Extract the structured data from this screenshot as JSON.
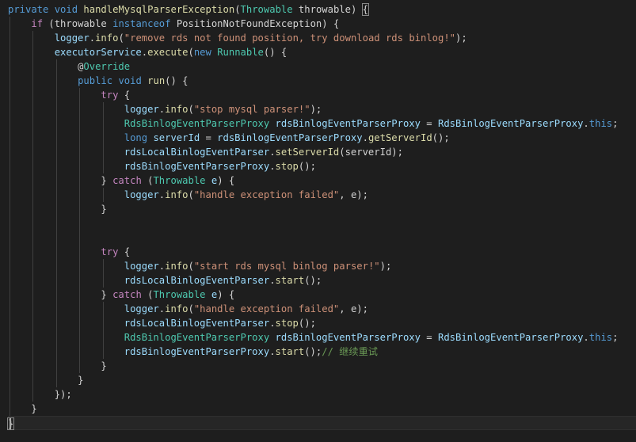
{
  "editor": {
    "lines": [
      {
        "tokens": [
          {
            "t": "private",
            "c": "kw"
          },
          {
            "t": " ",
            "c": "pn"
          },
          {
            "t": "void",
            "c": "kw"
          },
          {
            "t": " ",
            "c": "pn"
          },
          {
            "t": "handleMysqlParserException",
            "c": "fn"
          },
          {
            "t": "(",
            "c": "pn"
          },
          {
            "t": "Throwable",
            "c": "ty"
          },
          {
            "t": " throwable) ",
            "c": "pn"
          },
          {
            "t": "{",
            "c": "pn brk"
          }
        ]
      },
      {
        "tokens": [
          {
            "t": "    ",
            "c": "pn"
          },
          {
            "t": "if",
            "c": "ctl"
          },
          {
            "t": " (throwable ",
            "c": "pn"
          },
          {
            "t": "instanceof",
            "c": "kw"
          },
          {
            "t": " PositionNotFoundException) {",
            "c": "pn"
          }
        ]
      },
      {
        "tokens": [
          {
            "t": "        ",
            "c": "pn"
          },
          {
            "t": "logger",
            "c": "var"
          },
          {
            "t": ".",
            "c": "pn"
          },
          {
            "t": "info",
            "c": "fn"
          },
          {
            "t": "(",
            "c": "pn"
          },
          {
            "t": "\"remove rds not found position, try download rds binlog!\"",
            "c": "str"
          },
          {
            "t": ");",
            "c": "pn"
          }
        ]
      },
      {
        "tokens": [
          {
            "t": "        ",
            "c": "pn"
          },
          {
            "t": "executorService",
            "c": "var"
          },
          {
            "t": ".",
            "c": "pn"
          },
          {
            "t": "execute",
            "c": "fn"
          },
          {
            "t": "(",
            "c": "pn"
          },
          {
            "t": "new",
            "c": "kw"
          },
          {
            "t": " ",
            "c": "pn"
          },
          {
            "t": "Runnable",
            "c": "ty"
          },
          {
            "t": "() {",
            "c": "pn"
          }
        ]
      },
      {
        "tokens": [
          {
            "t": "            ",
            "c": "pn"
          },
          {
            "t": "@",
            "c": "pn"
          },
          {
            "t": "Override",
            "c": "ty"
          }
        ]
      },
      {
        "tokens": [
          {
            "t": "            ",
            "c": "pn"
          },
          {
            "t": "public",
            "c": "kw"
          },
          {
            "t": " ",
            "c": "pn"
          },
          {
            "t": "void",
            "c": "kw"
          },
          {
            "t": " ",
            "c": "pn"
          },
          {
            "t": "run",
            "c": "fn"
          },
          {
            "t": "() {",
            "c": "pn"
          }
        ]
      },
      {
        "tokens": [
          {
            "t": "                ",
            "c": "pn"
          },
          {
            "t": "try",
            "c": "ctl"
          },
          {
            "t": " {",
            "c": "pn"
          }
        ]
      },
      {
        "tokens": [
          {
            "t": "                    ",
            "c": "pn"
          },
          {
            "t": "logger",
            "c": "var"
          },
          {
            "t": ".",
            "c": "pn"
          },
          {
            "t": "info",
            "c": "fn"
          },
          {
            "t": "(",
            "c": "pn"
          },
          {
            "t": "\"stop mysql parser!\"",
            "c": "str"
          },
          {
            "t": ");",
            "c": "pn"
          }
        ]
      },
      {
        "tokens": [
          {
            "t": "                    ",
            "c": "pn"
          },
          {
            "t": "RdsBinlogEventParserProxy",
            "c": "ty"
          },
          {
            "t": " ",
            "c": "pn"
          },
          {
            "t": "rdsBinlogEventParserProxy",
            "c": "var"
          },
          {
            "t": " = ",
            "c": "pn"
          },
          {
            "t": "RdsBinlogEventParserProxy",
            "c": "var"
          },
          {
            "t": ".",
            "c": "pn"
          },
          {
            "t": "this",
            "c": "kw"
          },
          {
            "t": ";",
            "c": "pn"
          }
        ]
      },
      {
        "tokens": [
          {
            "t": "                    ",
            "c": "pn"
          },
          {
            "t": "long",
            "c": "kw"
          },
          {
            "t": " ",
            "c": "pn"
          },
          {
            "t": "serverId",
            "c": "var"
          },
          {
            "t": " = ",
            "c": "pn"
          },
          {
            "t": "rdsBinlogEventParserProxy",
            "c": "var"
          },
          {
            "t": ".",
            "c": "pn"
          },
          {
            "t": "getServerId",
            "c": "fn"
          },
          {
            "t": "();",
            "c": "pn"
          }
        ]
      },
      {
        "tokens": [
          {
            "t": "                    ",
            "c": "pn"
          },
          {
            "t": "rdsLocalBinlogEventParser",
            "c": "var"
          },
          {
            "t": ".",
            "c": "pn"
          },
          {
            "t": "setServerId",
            "c": "fn"
          },
          {
            "t": "(serverId);",
            "c": "pn"
          }
        ]
      },
      {
        "tokens": [
          {
            "t": "                    ",
            "c": "pn"
          },
          {
            "t": "rdsBinlogEventParserProxy",
            "c": "var"
          },
          {
            "t": ".",
            "c": "pn"
          },
          {
            "t": "stop",
            "c": "fn"
          },
          {
            "t": "();",
            "c": "pn"
          }
        ]
      },
      {
        "tokens": [
          {
            "t": "                ",
            "c": "pn"
          },
          {
            "t": "} ",
            "c": "pn"
          },
          {
            "t": "catch",
            "c": "ctl"
          },
          {
            "t": " (",
            "c": "pn"
          },
          {
            "t": "Throwable",
            "c": "ty"
          },
          {
            "t": " ",
            "c": "pn"
          },
          {
            "t": "e",
            "c": "var"
          },
          {
            "t": ") {",
            "c": "pn"
          }
        ]
      },
      {
        "tokens": [
          {
            "t": "                    ",
            "c": "pn"
          },
          {
            "t": "logger",
            "c": "var"
          },
          {
            "t": ".",
            "c": "pn"
          },
          {
            "t": "info",
            "c": "fn"
          },
          {
            "t": "(",
            "c": "pn"
          },
          {
            "t": "\"handle exception failed\"",
            "c": "str"
          },
          {
            "t": ", e);",
            "c": "pn"
          }
        ]
      },
      {
        "tokens": [
          {
            "t": "                ",
            "c": "pn"
          },
          {
            "t": "}",
            "c": "pn"
          }
        ]
      },
      {
        "tokens": []
      },
      {
        "tokens": []
      },
      {
        "tokens": [
          {
            "t": "                ",
            "c": "pn"
          },
          {
            "t": "try",
            "c": "ctl"
          },
          {
            "t": " {",
            "c": "pn"
          }
        ]
      },
      {
        "tokens": [
          {
            "t": "                    ",
            "c": "pn"
          },
          {
            "t": "logger",
            "c": "var"
          },
          {
            "t": ".",
            "c": "pn"
          },
          {
            "t": "info",
            "c": "fn"
          },
          {
            "t": "(",
            "c": "pn"
          },
          {
            "t": "\"start rds mysql binlog parser!\"",
            "c": "str"
          },
          {
            "t": ");",
            "c": "pn"
          }
        ]
      },
      {
        "tokens": [
          {
            "t": "                    ",
            "c": "pn"
          },
          {
            "t": "rdsLocalBinlogEventParser",
            "c": "var"
          },
          {
            "t": ".",
            "c": "pn"
          },
          {
            "t": "start",
            "c": "fn"
          },
          {
            "t": "();",
            "c": "pn"
          }
        ]
      },
      {
        "tokens": [
          {
            "t": "                ",
            "c": "pn"
          },
          {
            "t": "} ",
            "c": "pn"
          },
          {
            "t": "catch",
            "c": "ctl"
          },
          {
            "t": " (",
            "c": "pn"
          },
          {
            "t": "Throwable",
            "c": "ty"
          },
          {
            "t": " ",
            "c": "pn"
          },
          {
            "t": "e",
            "c": "var"
          },
          {
            "t": ") {",
            "c": "pn"
          }
        ]
      },
      {
        "tokens": [
          {
            "t": "                    ",
            "c": "pn"
          },
          {
            "t": "logger",
            "c": "var"
          },
          {
            "t": ".",
            "c": "pn"
          },
          {
            "t": "info",
            "c": "fn"
          },
          {
            "t": "(",
            "c": "pn"
          },
          {
            "t": "\"handle exception failed\"",
            "c": "str"
          },
          {
            "t": ", e);",
            "c": "pn"
          }
        ]
      },
      {
        "tokens": [
          {
            "t": "                    ",
            "c": "pn"
          },
          {
            "t": "rdsLocalBinlogEventParser",
            "c": "var"
          },
          {
            "t": ".",
            "c": "pn"
          },
          {
            "t": "stop",
            "c": "fn"
          },
          {
            "t": "();",
            "c": "pn"
          }
        ]
      },
      {
        "tokens": [
          {
            "t": "                    ",
            "c": "pn"
          },
          {
            "t": "RdsBinlogEventParserProxy",
            "c": "ty"
          },
          {
            "t": " ",
            "c": "pn"
          },
          {
            "t": "rdsBinlogEventParserProxy",
            "c": "var"
          },
          {
            "t": " = ",
            "c": "pn"
          },
          {
            "t": "RdsBinlogEventParserProxy",
            "c": "var"
          },
          {
            "t": ".",
            "c": "pn"
          },
          {
            "t": "this",
            "c": "kw"
          },
          {
            "t": ";",
            "c": "pn"
          }
        ]
      },
      {
        "tokens": [
          {
            "t": "                    ",
            "c": "pn"
          },
          {
            "t": "rdsBinlogEventParserProxy",
            "c": "var"
          },
          {
            "t": ".",
            "c": "pn"
          },
          {
            "t": "start",
            "c": "fn"
          },
          {
            "t": "();",
            "c": "pn"
          },
          {
            "t": "// 继续重试",
            "c": "cm"
          }
        ]
      },
      {
        "tokens": [
          {
            "t": "                ",
            "c": "pn"
          },
          {
            "t": "}",
            "c": "pn"
          }
        ]
      },
      {
        "tokens": [
          {
            "t": "            ",
            "c": "pn"
          },
          {
            "t": "}",
            "c": "pn"
          }
        ]
      },
      {
        "tokens": [
          {
            "t": "        ",
            "c": "pn"
          },
          {
            "t": "});",
            "c": "pn"
          }
        ]
      },
      {
        "tokens": [
          {
            "t": "    ",
            "c": "pn"
          },
          {
            "t": "}",
            "c": "pn"
          }
        ]
      },
      {
        "tokens": [
          {
            "t": "}",
            "c": "pn brk"
          }
        ],
        "current": true
      }
    ]
  },
  "theme": {
    "background": "#1e1e1e",
    "keyword": "#569cd6",
    "control": "#c586c0",
    "type": "#4ec9b0",
    "function": "#dcdcaa",
    "variable": "#9cdcfe",
    "string": "#ce9178",
    "comment": "#6a9955",
    "punctuation": "#d4d4d4"
  }
}
